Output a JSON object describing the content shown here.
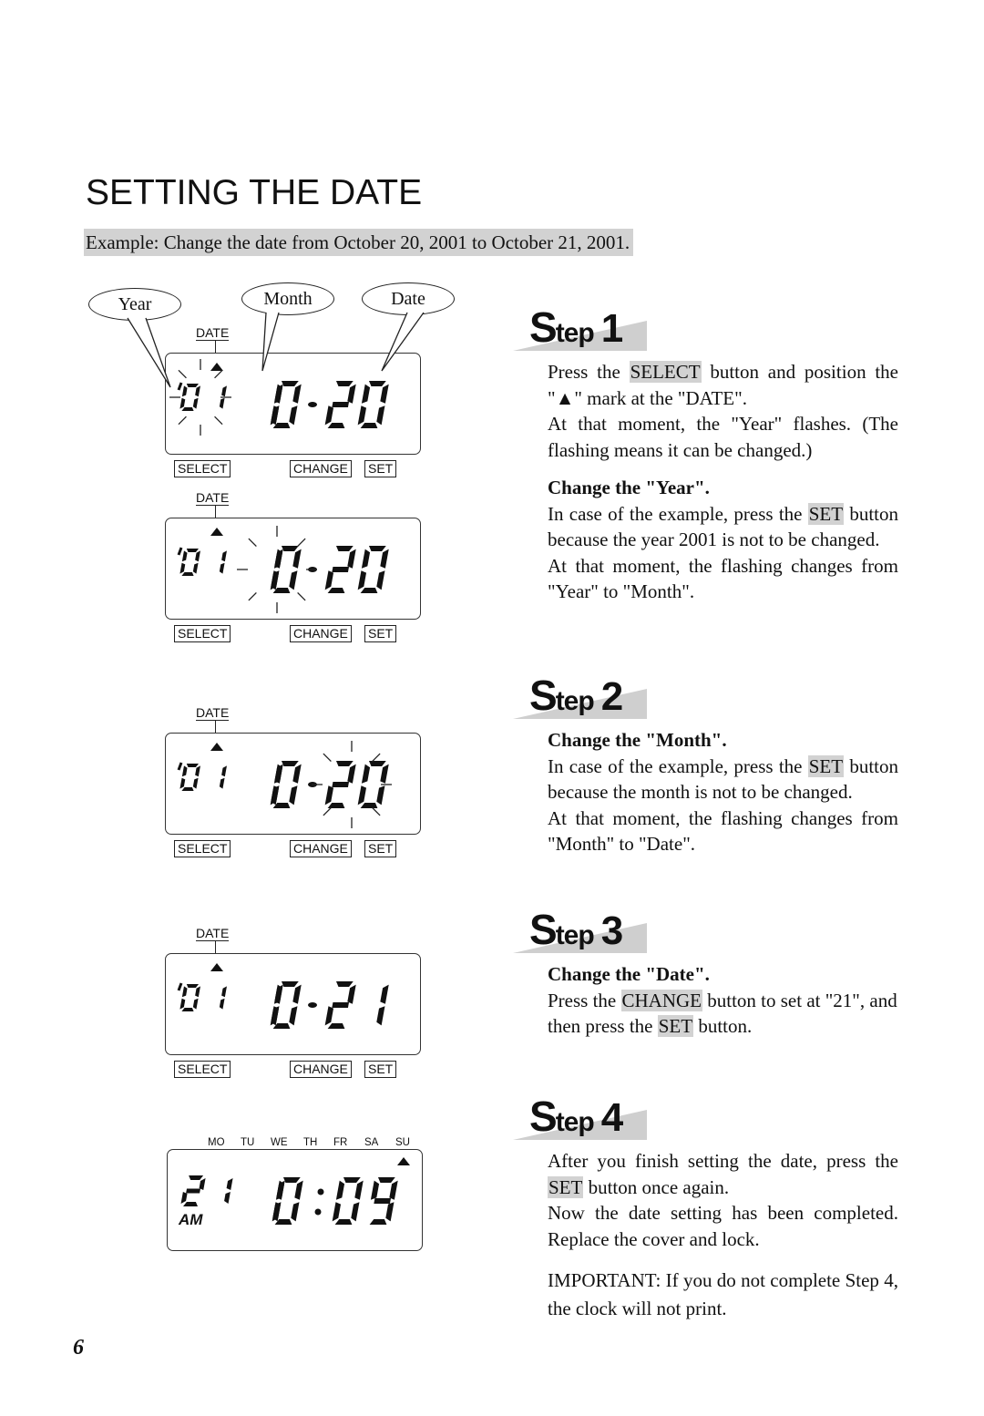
{
  "page": {
    "title": "SETTING THE DATE",
    "example": "Example: Change the date from October 20, 2001 to October 21, 2001.",
    "page_number": "6"
  },
  "callouts": {
    "year": "Year",
    "month": "Month",
    "date": "Date"
  },
  "panels": [
    {
      "label": "DATE",
      "year_prefix": "'",
      "left": "01",
      "right": "10-20",
      "flashing": "year",
      "buttons": [
        "SELECT",
        "CHANGE",
        "SET"
      ]
    },
    {
      "label": "DATE",
      "year_prefix": "'",
      "left": "01",
      "right": "10-20",
      "flashing": "month",
      "buttons": [
        "SELECT",
        "CHANGE",
        "SET"
      ]
    },
    {
      "label": "DATE",
      "year_prefix": "'",
      "left": "01",
      "right": "10-20",
      "flashing": "date",
      "buttons": [
        "SELECT",
        "CHANGE",
        "SET"
      ]
    },
    {
      "label": "DATE",
      "year_prefix": "'",
      "left": "01",
      "right": "10-21",
      "flashing": "none",
      "buttons": [
        "SELECT",
        "CHANGE",
        "SET"
      ]
    }
  ],
  "final_panel": {
    "days": [
      "MO",
      "TU",
      "WE",
      "TH",
      "FR",
      "SA",
      "SU"
    ],
    "active_day": "SU",
    "left": "21",
    "ampm": "AM",
    "right": "10:09"
  },
  "steps": [
    {
      "word": "Step",
      "number": "1",
      "p1_pre": "Press the ",
      "p1_hl": "SELECT",
      "p1_post": " button and position the \"▲\" mark at the \"DATE\".",
      "p2": "At that moment, the \"Year\" flashes. (The flashing means it can be changed.)",
      "sub_heading": "Change the \"Year\".",
      "p3_pre": "In case of the example, press the ",
      "p3_hl": "SET",
      "p3_post": " button because the year 2001 is not to be changed.",
      "p4": "At that moment, the flashing changes from \"Year\" to \"Month\"."
    },
    {
      "word": "Step",
      "number": "2",
      "sub_heading": "Change the \"Month\".",
      "p1_pre": "In case of the example, press the ",
      "p1_hl": "SET",
      "p1_post": " button because the month is not to be changed.",
      "p2": "At that moment, the flashing changes from \"Month\" to \"Date\"."
    },
    {
      "word": "Step",
      "number": "3",
      "sub_heading": "Change the \"Date\".",
      "p1_pre": "Press the ",
      "p1_hl": "CHANGE",
      "p1_mid": " button to set at \"21\", and then press the ",
      "p1_hl2": "SET",
      "p1_post": " button."
    },
    {
      "word": "Step",
      "number": "4",
      "p1_pre": "After you finish setting the date, press the ",
      "p1_hl": "SET",
      "p1_post": " button once again.",
      "p2": "Now the date setting has been completed. Replace the cover and lock.",
      "important": "IMPORTANT: If you do not complete Step 4, the clock will not print."
    }
  ],
  "colors": {
    "highlight": "#d2d2d2",
    "step_wedge": "#cfcfcf",
    "ink": "#111111"
  }
}
